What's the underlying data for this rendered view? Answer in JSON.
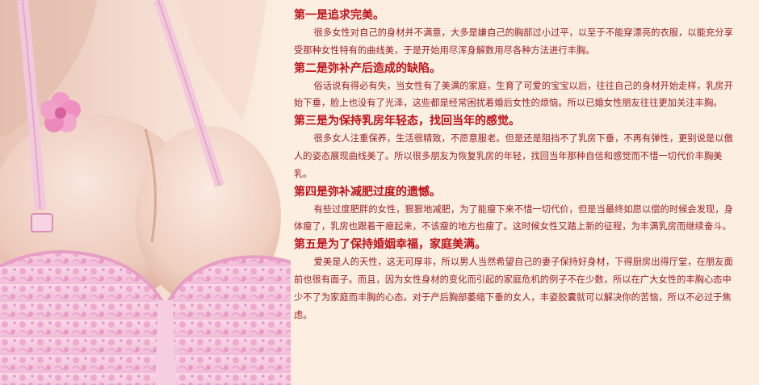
{
  "image": {
    "description": "",
    "colors": {
      "background": "#fcefe2",
      "bra": "#f4c8de",
      "lace": "#ec9cc6",
      "skin": "#f2d5c8",
      "title": "#c0141b",
      "body_text": "#9a1a1f"
    }
  },
  "sections": [
    {
      "title": "第一是追求完美。",
      "body": "很多女性对自己的身材并不满意，大多是嫌自己的胸部过小过平，以至于不能穿漂亮的衣服，以能充分享受那种女性特有的曲线美，于是开始用尽浑身解数用尽各种方法进行丰胸。"
    },
    {
      "title": "第二是弥补产后造成的缺陷。",
      "body": "俗话说有得必有失，当女性有了美满的家庭，生育了可爱的宝宝以后，往往自己的身材开始走样，乳房开始下垂，脸上也没有了光泽，这些都是经常困扰着婚后女性的烦恼。所以已婚女性朋友往往更加关注丰胸。"
    },
    {
      "title": "第三是为保持乳房年轻态，找回当年的感觉。",
      "body": "很多女人注重保养，生活很精致，不愿意服老。但是还是阻挡不了乳房下垂，不再有弹性，更别说是以傲人的姿态展现曲线美了。所以很多朋友为恢复乳房的年轻，找回当年那种自信和感觉而不惜一切代价丰胸美乳。"
    },
    {
      "title": "第四是弥补减肥过度的遗憾。",
      "body": "有些过度肥胖的女性，狠狠地减肥，为了能瘦下来不惜一切代价，但是当最终如愿以偿的时候会发现，身体瘦了，乳房也跟着干瘪起来，不该瘦的地方也瘦了。这时候女性又踏上新的征程，为丰满乳房而继续奋斗。"
    },
    {
      "title": "第五是为了保持婚姻幸福，家庭美满。",
      "body": "爱美是人的天性，这无可厚非，所以男人当然希望自己的妻子保持好身材，下得厨房出得厅堂，在朋友面前也很有面子。而且，因为女性身材的变化而引起的家庭危机的例子不在少数，所以在广大女性的丰胸心态中少不了为家庭而丰胸的心态。对于产后胸部萎缩下垂的女人，丰姿胶囊就可以解决你的苦恼，所以不必过于焦虑。"
    }
  ]
}
